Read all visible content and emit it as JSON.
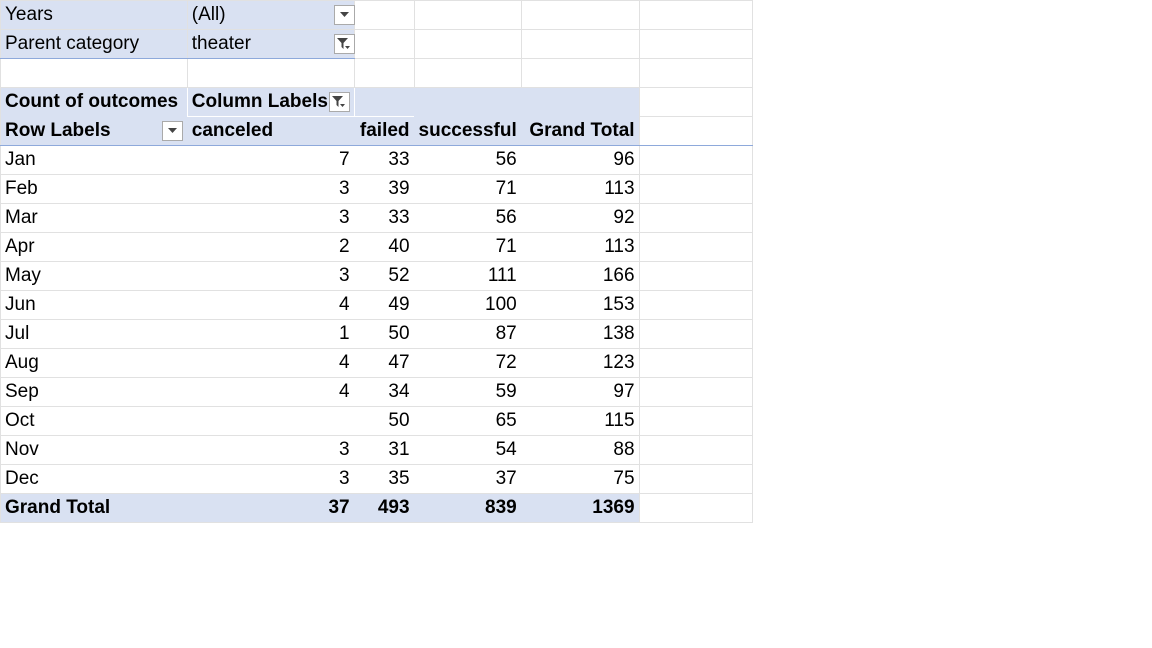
{
  "filters": [
    {
      "label": "Years",
      "value": "(All)",
      "icon": "dropdown-arrow-icon"
    },
    {
      "label": "Parent category",
      "value": "theater",
      "icon": "filter-active-icon"
    }
  ],
  "pivot": {
    "value_field": "Count of outcomes",
    "column_labels": "Column Labels",
    "row_labels": "Row Labels",
    "columns": [
      "canceled",
      "failed",
      "successful",
      "Grand Total"
    ],
    "rows": [
      {
        "label": "Jan",
        "canceled": "7",
        "failed": "33",
        "successful": "56",
        "total": "96"
      },
      {
        "label": "Feb",
        "canceled": "3",
        "failed": "39",
        "successful": "71",
        "total": "113"
      },
      {
        "label": "Mar",
        "canceled": "3",
        "failed": "33",
        "successful": "56",
        "total": "92"
      },
      {
        "label": "Apr",
        "canceled": "2",
        "failed": "40",
        "successful": "71",
        "total": "113"
      },
      {
        "label": "May",
        "canceled": "3",
        "failed": "52",
        "successful": "111",
        "total": "166"
      },
      {
        "label": "Jun",
        "canceled": "4",
        "failed": "49",
        "successful": "100",
        "total": "153"
      },
      {
        "label": "Jul",
        "canceled": "1",
        "failed": "50",
        "successful": "87",
        "total": "138"
      },
      {
        "label": "Aug",
        "canceled": "4",
        "failed": "47",
        "successful": "72",
        "total": "123"
      },
      {
        "label": "Sep",
        "canceled": "4",
        "failed": "34",
        "successful": "59",
        "total": "97"
      },
      {
        "label": "Oct",
        "canceled": "",
        "failed": "50",
        "successful": "65",
        "total": "115"
      },
      {
        "label": "Nov",
        "canceled": "3",
        "failed": "31",
        "successful": "54",
        "total": "88"
      },
      {
        "label": "Dec",
        "canceled": "3",
        "failed": "35",
        "successful": "37",
        "total": "75"
      }
    ],
    "grand_total": {
      "label": "Grand Total",
      "canceled": "37",
      "failed": "493",
      "successful": "839",
      "total": "1369"
    }
  },
  "colors": {
    "pivot_header_fill": "#d9e1f2",
    "gridline": "#e1e1e1",
    "header_rule": "#8ea9db"
  }
}
